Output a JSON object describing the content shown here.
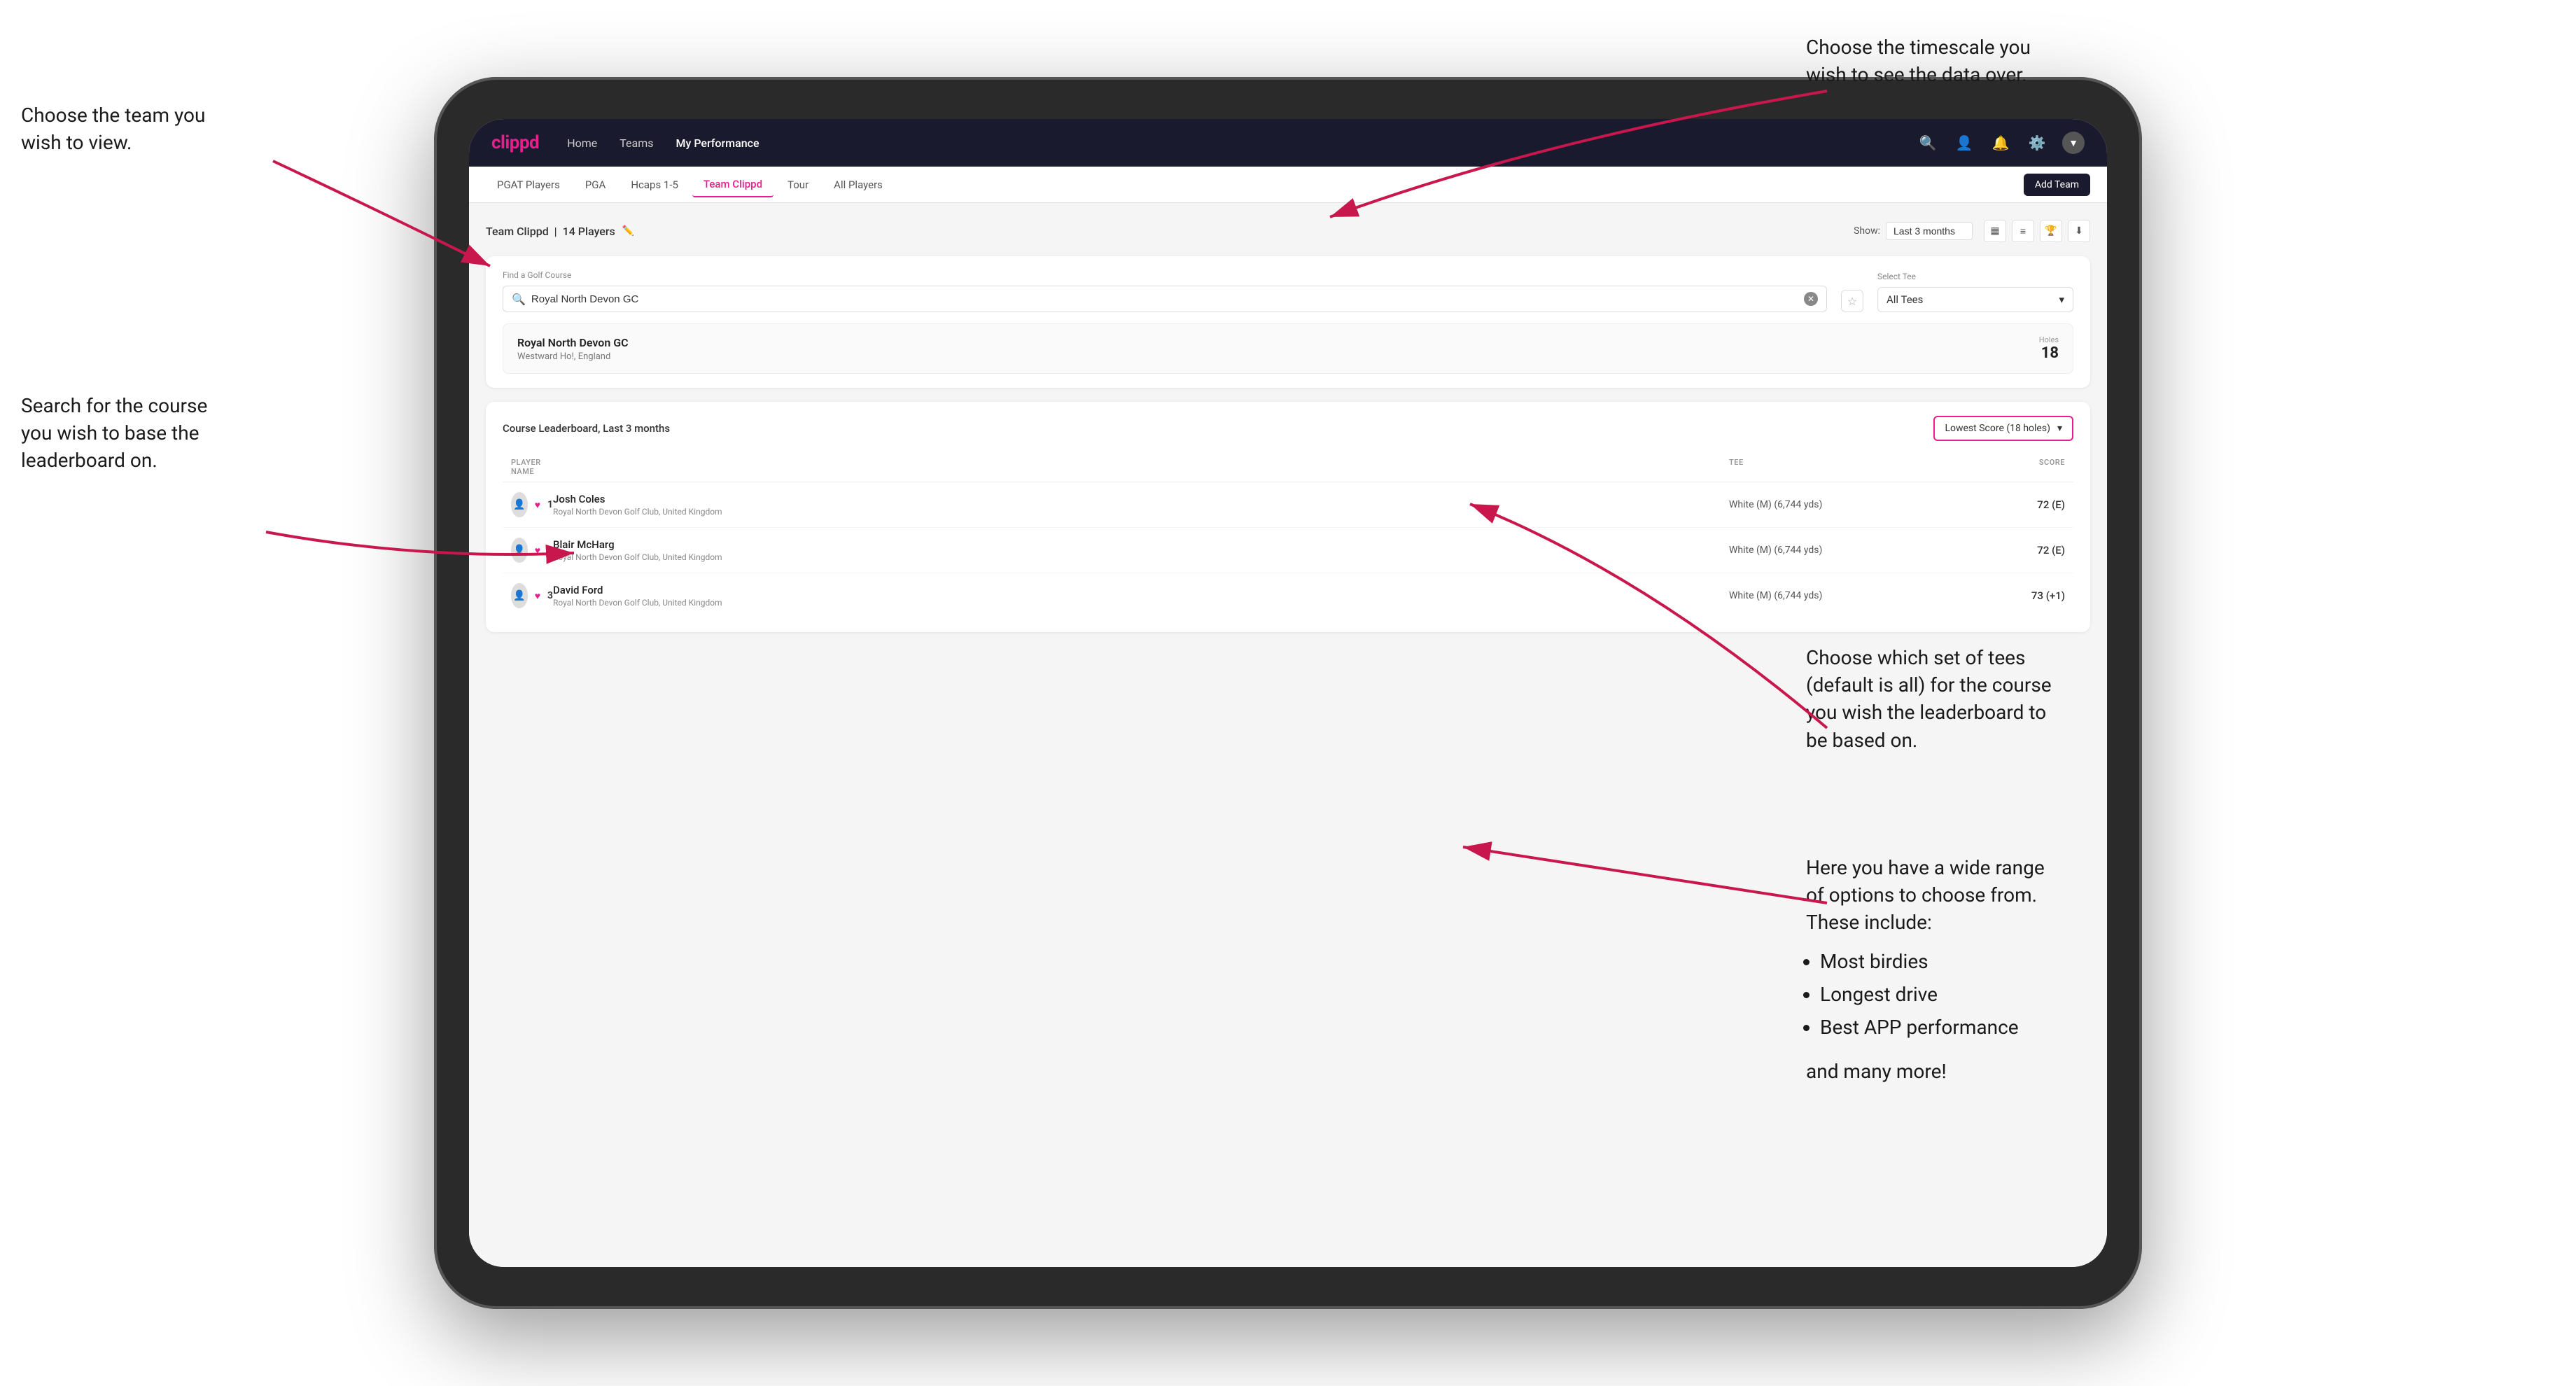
{
  "annotations": {
    "team_choice": "Choose the team you\nwish to view.",
    "timescale_choice": "Choose the timescale you\nwish to see the data over.",
    "tee_choice": "Choose which set of tees\n(default is all) for the course\nyou wish the leaderboard to\nbe based on.",
    "course_search": "Search for the course\nyou wish to base the\nleaderboard on.",
    "options_intro": "Here you have a wide range\nof options to choose from.\nThese include:",
    "options_bullets": [
      "Most birdies",
      "Longest drive",
      "Best APP performance"
    ],
    "options_extra": "and many more!"
  },
  "nav": {
    "logo": "clippd",
    "links": [
      "Home",
      "Teams",
      "My Performance"
    ],
    "active_link": "My Performance"
  },
  "sub_nav": {
    "tabs": [
      "PGAT Players",
      "PGA",
      "Hcaps 1-5",
      "Team Clippd",
      "Tour",
      "All Players"
    ],
    "active_tab": "Team Clippd",
    "add_team_label": "Add Team"
  },
  "team_header": {
    "title": "Team Clippd",
    "player_count": "14 Players",
    "show_label": "Show:",
    "show_value": "Last 3 months"
  },
  "search_section": {
    "find_label": "Find a Golf Course",
    "find_placeholder": "Royal North Devon GC",
    "tee_label": "Select Tee",
    "tee_value": "All Tees"
  },
  "course_result": {
    "name": "Royal North Devon GC",
    "location": "Westward Ho!, England",
    "holes_label": "Holes",
    "holes_value": "18"
  },
  "leaderboard": {
    "title": "Course Leaderboard,",
    "subtitle": "Last 3 months",
    "score_type": "Lowest Score (18 holes)",
    "columns": [
      "PLAYER NAME",
      "TEE",
      "SCORE"
    ],
    "players": [
      {
        "rank": "1",
        "name": "Josh Coles",
        "club": "Royal North Devon Golf Club, United Kingdom",
        "tee": "White (M) (6,744 yds)",
        "score": "72 (E)"
      },
      {
        "rank": "1",
        "name": "Blair McHarg",
        "club": "Royal North Devon Golf Club, United Kingdom",
        "tee": "White (M) (6,744 yds)",
        "score": "72 (E)"
      },
      {
        "rank": "3",
        "name": "David Ford",
        "club": "Royal North Devon Golf Club, United Kingdom",
        "tee": "White (M) (6,744 yds)",
        "score": "73 (+1)"
      }
    ]
  }
}
